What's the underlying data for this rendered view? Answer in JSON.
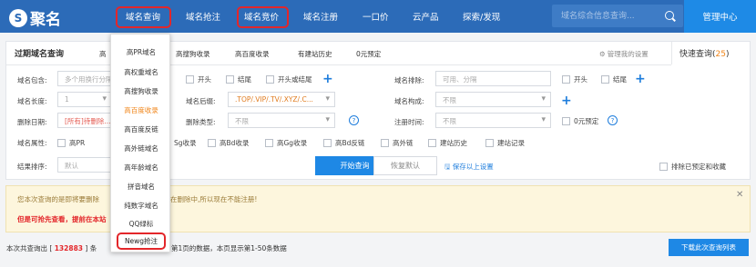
{
  "logo": {
    "mark": "S",
    "text": "聚名"
  },
  "nav": [
    {
      "label": "域名查询",
      "highlighted": true
    },
    {
      "label": "域名抢注",
      "highlighted": false
    },
    {
      "label": "域名竞价",
      "highlighted": true
    },
    {
      "label": "域名注册",
      "highlighted": false
    },
    {
      "label": "一口价",
      "highlighted": false
    },
    {
      "label": "云产品",
      "highlighted": false
    },
    {
      "label": "探索/发现",
      "highlighted": false
    }
  ],
  "search": {
    "placeholder": "域名综合信息查询..."
  },
  "manage_center": "管理中心",
  "tabs": [
    "过期域名查询",
    "高",
    "高搜狗收录",
    "高百度收录",
    "有建站历史",
    "0元预定"
  ],
  "manage_settings": "管理我的设置",
  "quick_query": {
    "label": "快速查询",
    "count": "25"
  },
  "form": {
    "contains": {
      "label": "域名包含:",
      "placeholder": "多个用换行分隔"
    },
    "contains_opts": [
      "开头",
      "结尾",
      "开头或结尾"
    ],
    "exclude": {
      "label": "域名排除:",
      "placeholder": "可用、分隔"
    },
    "exclude_opts": [
      "开头",
      "结尾"
    ],
    "length": {
      "label": "域名长度:",
      "value": "1"
    },
    "suffix": {
      "label": "域名后缀:",
      "value": ".TOP/.VIP/.TV/.XYZ/.C..."
    },
    "structure": {
      "label": "域名构成:",
      "value": "不限"
    },
    "delete_date": {
      "label": "删除日期:",
      "value": "[所有]待删除..."
    },
    "delete_type": {
      "label": "删除类型:",
      "value": "不限"
    },
    "reg_time": {
      "label": "注册时间:",
      "value": "不限"
    },
    "zero_reserve": "0元预定",
    "attr_label": "域名属性:",
    "attrs": [
      "高PR",
      "Sg收录",
      "高Bd收录",
      "高Gg收录",
      "高Bd反链",
      "高外链",
      "建站历史",
      "建站记录"
    ],
    "sort": {
      "label": "结果排序:",
      "value": "默认"
    },
    "start": "开始查询",
    "reset": "恢复默认",
    "save": "保存以上设置",
    "exclude_reserved": "排除已预定和收藏"
  },
  "notice": {
    "line1": "您本次查询的是即将要删除",
    "line1b": "在删除中,所以现在不能注册!",
    "line2": "但是可抢先查看，提前在本站"
  },
  "footer": {
    "prefix": "本次共查询出 [",
    "count": "132883",
    "suffix": "] 条",
    "page_text": "第1页的数据，本页显示第1-50条数据",
    "download": "下载此次查询列表"
  },
  "dropdown_items": [
    "高PR域名",
    "高权重域名",
    "高搜狗收录",
    "高百度收录",
    "高百度反链",
    "高外链域名",
    "高年龄域名",
    "拼音域名",
    "纯数字域名",
    "QQ绿标",
    "Newg抢注"
  ]
}
